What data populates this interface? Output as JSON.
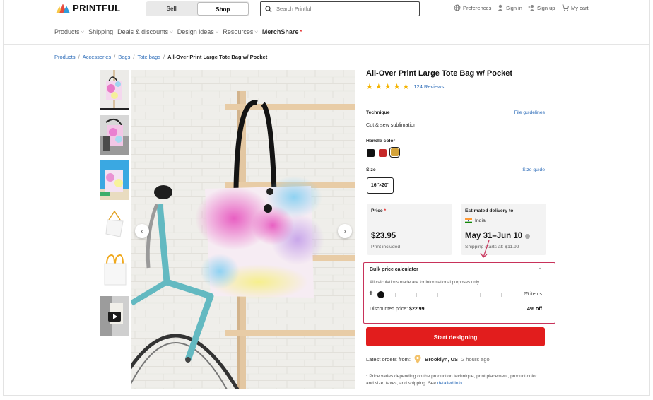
{
  "header": {
    "logo_text": "PRINTFUL",
    "toggle": {
      "sell_label": "Sell",
      "shop_label": "Shop",
      "active": "Shop"
    },
    "search_placeholder": "Search Printful",
    "preferences_label": "Preferences",
    "signin_label": "Sign in",
    "signup_label": "Sign up",
    "cart_label": "My cart"
  },
  "nav": {
    "items": [
      "Products",
      "Shipping",
      "Deals & discounts",
      "Design ideas",
      "Resources",
      "MerchShare"
    ]
  },
  "breadcrumb": [
    "Products",
    "Accessories",
    "Bags",
    "Tote bags",
    "All-Over Print Large Tote Bag w/ Pocket"
  ],
  "product": {
    "title": "All-Over Print Large Tote Bag w/ Pocket",
    "rating": 5,
    "reviews_label": "124 Reviews",
    "technique_label": "Technique",
    "file_guidelines_label": "File guidelines",
    "technique_value": "Cut & sew sublimation",
    "handle_color_label": "Handle color",
    "handle_colors": [
      "#111111",
      "#c62828",
      "#d4a33a"
    ],
    "size_label": "Size",
    "size_guide_label": "Size guide",
    "size_value": "16″×20″",
    "price_label": "Price",
    "price_value": "$23.95",
    "price_note": "Print included",
    "delivery_label": "Estimated delivery to",
    "delivery_country": "India",
    "delivery_dates": "May 31–Jun 10",
    "shipping_note": "Shipping starts at: $11.99"
  },
  "bulk": {
    "title": "Bulk price calculator",
    "subtitle": "All calculations made are for informational purposes only",
    "quantity_label": "25 items",
    "discounted_prefix": "Discounted price:",
    "discounted_value": "$22.99",
    "discount_pct": "4% off"
  },
  "cta_label": "Start designing",
  "latest": {
    "prefix": "Latest orders from:",
    "city": "Brooklyn, US",
    "ago": "2 hours ago"
  },
  "footnote": {
    "text": "* Price varies depending on the production technique, print placement, product color and size, taxes, and shipping. See",
    "link": "detailed info"
  },
  "colors": {
    "accent": "#e21d1d",
    "link": "#2b6bb8",
    "highlight": "#c8325a"
  }
}
